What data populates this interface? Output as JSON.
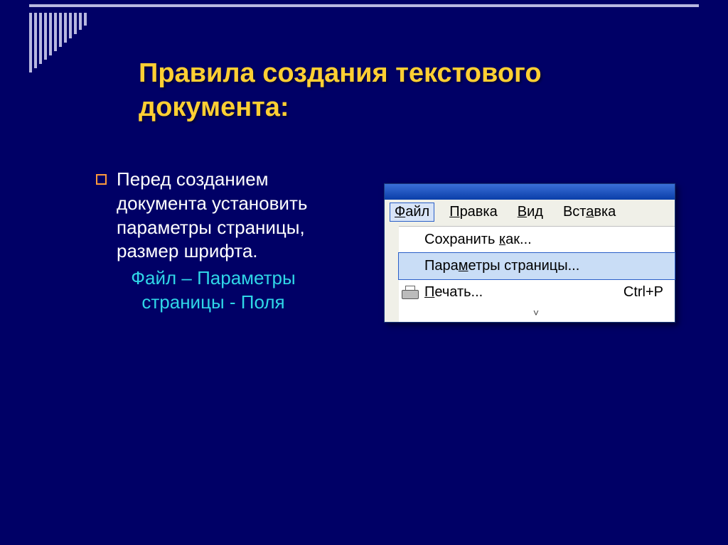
{
  "slide": {
    "title": "Правила создания текстового документа:",
    "body": "Перед созданием документа установить параметры страницы, размер шрифта.",
    "highlight": "Файл – Параметры страницы - Поля"
  },
  "win": {
    "menubar": [
      {
        "pre": "",
        "u": "Ф",
        "post": "айл"
      },
      {
        "pre": "",
        "u": "П",
        "post": "равка"
      },
      {
        "pre": "",
        "u": "В",
        "post": "ид"
      },
      {
        "pre": "Вст",
        "u": "а",
        "post": "вка"
      }
    ],
    "items": {
      "save_as": {
        "pre": "Сохранить ",
        "u": "к",
        "post": "ак..."
      },
      "page_setup": {
        "pre": "Пара",
        "u": "м",
        "post": "етры страницы..."
      },
      "print": {
        "pre": "",
        "u": "П",
        "post": "ечать...",
        "shortcut": "Ctrl+P"
      }
    },
    "expand": "˅"
  }
}
